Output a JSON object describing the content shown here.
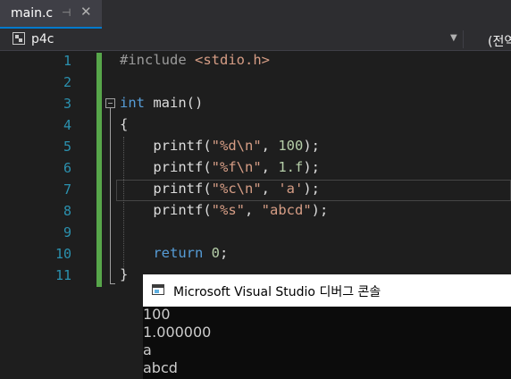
{
  "tab": {
    "title": "main.c",
    "pin_icon": "pin-icon",
    "close_icon": "close-icon"
  },
  "navbar": {
    "scope": "p4c",
    "scope_icon": "project-scope-icon",
    "right_scope": "(전역"
  },
  "editor": {
    "line_numbers": [
      "1",
      "2",
      "3",
      "4",
      "5",
      "6",
      "7",
      "8",
      "9",
      "10",
      "11"
    ],
    "lines": [
      [
        {
          "t": "#include ",
          "c": "pre"
        },
        {
          "t": "<stdio.h>",
          "c": "inc"
        }
      ],
      [],
      [
        {
          "t": "int",
          "c": "kw"
        },
        {
          "t": " main()",
          "c": "fn"
        }
      ],
      [
        {
          "t": "{",
          "c": "fn"
        }
      ],
      [
        {
          "t": "    printf(",
          "c": "fn"
        },
        {
          "t": "\"%d",
          "c": "str"
        },
        {
          "t": "\\n",
          "c": "esc"
        },
        {
          "t": "\"",
          "c": "str"
        },
        {
          "t": ", ",
          "c": "fn"
        },
        {
          "t": "100",
          "c": "num"
        },
        {
          "t": ");",
          "c": "fn"
        }
      ],
      [
        {
          "t": "    printf(",
          "c": "fn"
        },
        {
          "t": "\"%f",
          "c": "str"
        },
        {
          "t": "\\n",
          "c": "esc"
        },
        {
          "t": "\"",
          "c": "str"
        },
        {
          "t": ", ",
          "c": "fn"
        },
        {
          "t": "1.f",
          "c": "num"
        },
        {
          "t": ");",
          "c": "fn"
        }
      ],
      [
        {
          "t": "    printf(",
          "c": "fn"
        },
        {
          "t": "\"%c",
          "c": "str"
        },
        {
          "t": "\\n",
          "c": "esc"
        },
        {
          "t": "\"",
          "c": "str"
        },
        {
          "t": ", ",
          "c": "fn"
        },
        {
          "t": "'a'",
          "c": "str"
        },
        {
          "t": ");",
          "c": "fn"
        }
      ],
      [
        {
          "t": "    printf(",
          "c": "fn"
        },
        {
          "t": "\"%s\"",
          "c": "str"
        },
        {
          "t": ", ",
          "c": "fn"
        },
        {
          "t": "\"abcd\"",
          "c": "str"
        },
        {
          "t": ");",
          "c": "fn"
        }
      ],
      [],
      [
        {
          "t": "    ",
          "c": "fn"
        },
        {
          "t": "return",
          "c": "kw"
        },
        {
          "t": " ",
          "c": "fn"
        },
        {
          "t": "0",
          "c": "num"
        },
        {
          "t": ";",
          "c": "fn"
        }
      ],
      [
        {
          "t": "}",
          "c": "fn"
        }
      ]
    ]
  },
  "console": {
    "title": "Microsoft Visual Studio 디버그 콘솔",
    "output": [
      "100",
      "1.000000",
      "a",
      "abcd"
    ]
  },
  "colors": {
    "accent": "#007acc",
    "change_bar": "#57a64a",
    "line_number": "#2b91af"
  }
}
